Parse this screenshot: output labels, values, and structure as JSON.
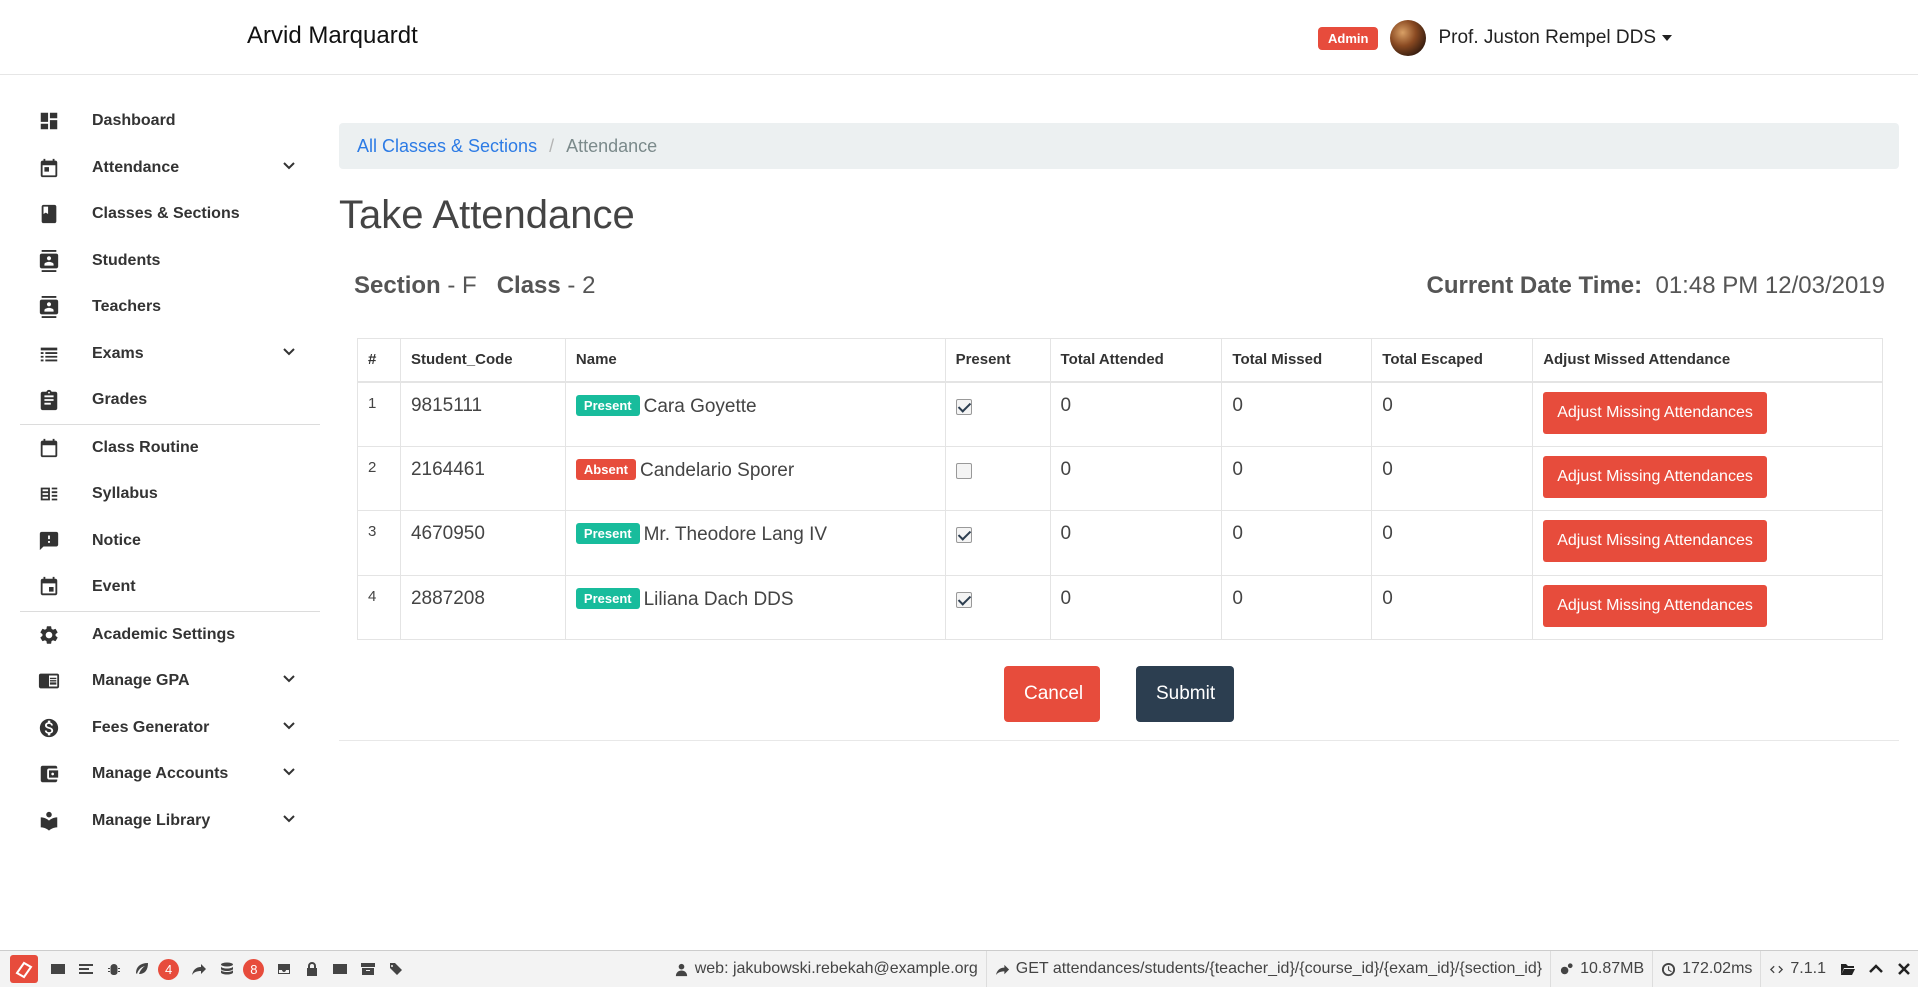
{
  "app": {
    "brand": "Arvid Marquardt"
  },
  "user": {
    "role_badge": "Admin",
    "name": "Prof. Juston Rempel DDS"
  },
  "sidebar": {
    "items": [
      {
        "label": "Dashboard",
        "icon": "dashboard-icon"
      },
      {
        "label": "Attendance",
        "icon": "calendar-icon",
        "expandable": true
      },
      {
        "label": "Classes & Sections",
        "icon": "book-icon"
      },
      {
        "label": "Students",
        "icon": "id-card-icon"
      },
      {
        "label": "Teachers",
        "icon": "id-card-icon"
      },
      {
        "label": "Exams",
        "icon": "list-icon",
        "expandable": true
      },
      {
        "label": "Grades",
        "icon": "clipboard-icon"
      },
      {
        "label": "Class Routine",
        "icon": "calendar-outline-icon"
      },
      {
        "label": "Syllabus",
        "icon": "syllabus-icon"
      },
      {
        "label": "Notice",
        "icon": "alert-message-icon"
      },
      {
        "label": "Event",
        "icon": "event-icon"
      },
      {
        "label": "Academic Settings",
        "icon": "gear-icon"
      },
      {
        "label": "Manage GPA",
        "icon": "gpa-card-icon",
        "expandable": true
      },
      {
        "label": "Fees Generator",
        "icon": "dollar-icon",
        "expandable": true
      },
      {
        "label": "Manage Accounts",
        "icon": "wallet-icon",
        "expandable": true
      },
      {
        "label": "Manage Library",
        "icon": "library-icon",
        "expandable": true
      }
    ]
  },
  "breadcrumb": {
    "link": "All Classes & Sections",
    "separator": "/",
    "current": "Attendance"
  },
  "page": {
    "title": "Take Attendance",
    "section_label": "Section",
    "section_value": " - F",
    "class_label": "Class",
    "class_value": " - 2",
    "datetime_label": "Current Date Time:",
    "datetime_value": "01:48 PM 12/03/2019"
  },
  "table": {
    "headers": [
      "#",
      "Student_Code",
      "Name",
      "Present",
      "Total Attended",
      "Total Missed",
      "Total Escaped",
      "Adjust Missed Attendance"
    ],
    "rows": [
      {
        "num": "1",
        "code": "9815111",
        "status": "Present",
        "name": "Cara Goyette",
        "present": true,
        "attended": "0",
        "missed": "0",
        "escaped": "0",
        "action": "Adjust Missing Attendances"
      },
      {
        "num": "2",
        "code": "2164461",
        "status": "Absent",
        "name": "Candelario Sporer",
        "present": false,
        "attended": "0",
        "missed": "0",
        "escaped": "0",
        "action": "Adjust Missing Attendances"
      },
      {
        "num": "3",
        "code": "4670950",
        "status": "Present",
        "name": "Mr. Theodore Lang IV",
        "present": true,
        "attended": "0",
        "missed": "0",
        "escaped": "0",
        "action": "Adjust Missing Attendances"
      },
      {
        "num": "4",
        "code": "2887208",
        "status": "Present",
        "name": "Liliana Dach DDS",
        "present": true,
        "attended": "0",
        "missed": "0",
        "escaped": "0",
        "action": "Adjust Missing Attendances"
      }
    ]
  },
  "actions": {
    "cancel": "Cancel",
    "submit": "Submit"
  },
  "debugbar": {
    "badge_views": "4",
    "badge_queries": "8",
    "user": "web: jakubowski.rebekah@example.org",
    "route": "GET attendances/students/{teacher_id}/{course_id}/{exam_id}/{section_id}",
    "memory": "10.87MB",
    "time": "172.02ms",
    "version": "7.1.1"
  },
  "colors": {
    "danger": "#e74c3c",
    "success": "#18bc9c",
    "primary_dark": "#2c3e50",
    "link": "#2c7be5"
  }
}
